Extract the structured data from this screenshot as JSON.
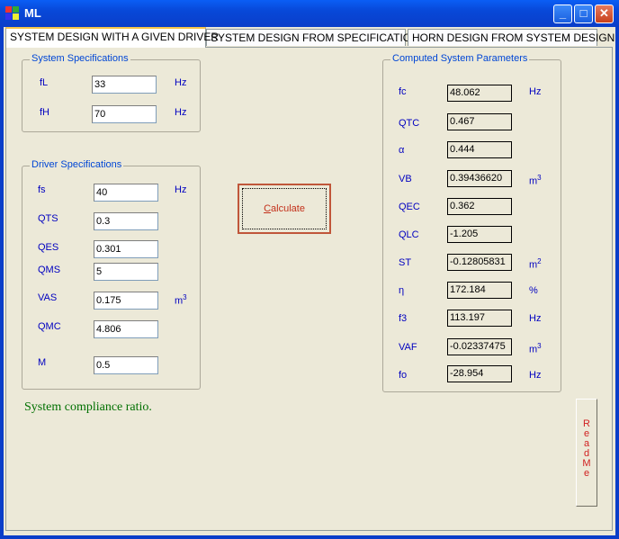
{
  "window": {
    "title": "ML",
    "buttons": {
      "minimize": "_",
      "maximize": "□",
      "close": "✕"
    }
  },
  "tabs": [
    {
      "label": "SYSTEM DESIGN WITH A GIVEN DRIVER",
      "active": true
    },
    {
      "label": "SYSTEM DESIGN FROM SPECIFICATIONS",
      "active": false
    },
    {
      "label": "HORN DESIGN FROM SYSTEM DESIGN",
      "active": false
    }
  ],
  "system_specs": {
    "title": "System Specifications",
    "fL": {
      "label": "fL",
      "value": "33",
      "unit": "Hz"
    },
    "fH": {
      "label": "fH",
      "value": "70",
      "unit": "Hz"
    }
  },
  "driver_specs": {
    "title": "Driver Specifications",
    "fs": {
      "label": "fs",
      "value": "40",
      "unit": "Hz"
    },
    "QTS": {
      "label": "QTS",
      "value": "0.3"
    },
    "QES": {
      "label": "QES",
      "value": "0.301"
    },
    "QMS": {
      "label": "QMS",
      "value": "5"
    },
    "VAS": {
      "label": "VAS",
      "value": "0.175",
      "unit": "m",
      "unit_sup": "3"
    },
    "QMC": {
      "label": "QMC",
      "value": "4.806"
    },
    "M": {
      "label": "M",
      "value": "0.5"
    }
  },
  "calculate": {
    "accel": "C",
    "rest": "alculate"
  },
  "computed": {
    "title": "Computed System Parameters",
    "fc": {
      "label": "fc",
      "value": "48.062",
      "unit": "Hz"
    },
    "QTC": {
      "label": "QTC",
      "value": "0.467"
    },
    "alpha": {
      "label": "α",
      "value": "0.444"
    },
    "VB": {
      "label": "VB",
      "value": "0.39436620",
      "unit": "m",
      "unit_sup": "3"
    },
    "QEC": {
      "label": "QEC",
      "value": "0.362"
    },
    "QLC": {
      "label": "QLC",
      "value": "-1.205"
    },
    "ST": {
      "label": "ST",
      "value": "-0.12805831",
      "unit": "m",
      "unit_sup": "2"
    },
    "eta": {
      "label": "η",
      "value": "172.184",
      "unit": "%"
    },
    "f3": {
      "label": "f3",
      "value": "113.197",
      "unit": "Hz"
    },
    "VAF": {
      "label": "VAF",
      "value": "-0.02337475",
      "unit": "m",
      "unit_sup": "3"
    },
    "fo": {
      "label": "fo",
      "value": "-28.954",
      "unit": "Hz"
    }
  },
  "status_text": "System compliance ratio.",
  "readme": {
    "letters": [
      "R",
      "e",
      "a",
      "d",
      "M",
      "e"
    ]
  }
}
